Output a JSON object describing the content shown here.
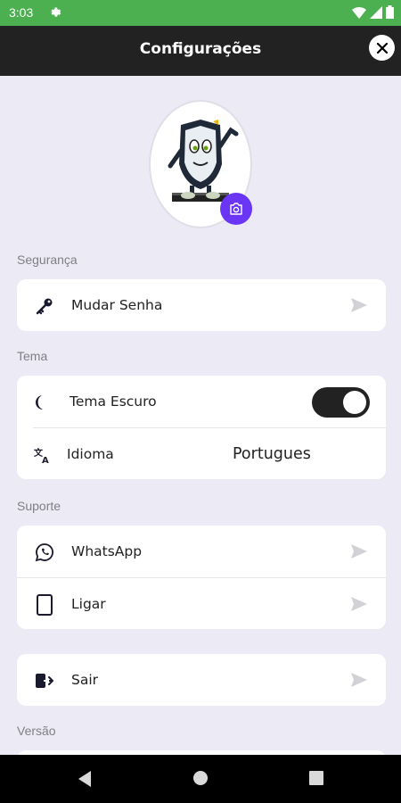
{
  "status_bar": {
    "time": "3:03"
  },
  "app_bar": {
    "title": "Configurações"
  },
  "sections": {
    "security": {
      "label": "Segurança",
      "items": [
        {
          "label": "Mudar Senha",
          "icon": "key-icon"
        }
      ]
    },
    "theme": {
      "label": "Tema",
      "dark_theme": {
        "label": "Tema Escuro",
        "icon": "moon-icon",
        "enabled": true
      },
      "language": {
        "label": "Idioma",
        "icon": "translate-icon",
        "value": "Portugues"
      }
    },
    "support": {
      "label": "Suporte",
      "items": [
        {
          "label": "WhatsApp",
          "icon": "whatsapp-icon"
        },
        {
          "label": "Ligar",
          "icon": "phone-icon"
        }
      ]
    },
    "logout": {
      "label": "Sair",
      "icon": "logout-icon"
    },
    "version": {
      "label": "Versão"
    }
  },
  "colors": {
    "status_bar": "#4caf50",
    "app_bar": "#222222",
    "accent": "#6a35f5",
    "background": "#eceaf4"
  }
}
